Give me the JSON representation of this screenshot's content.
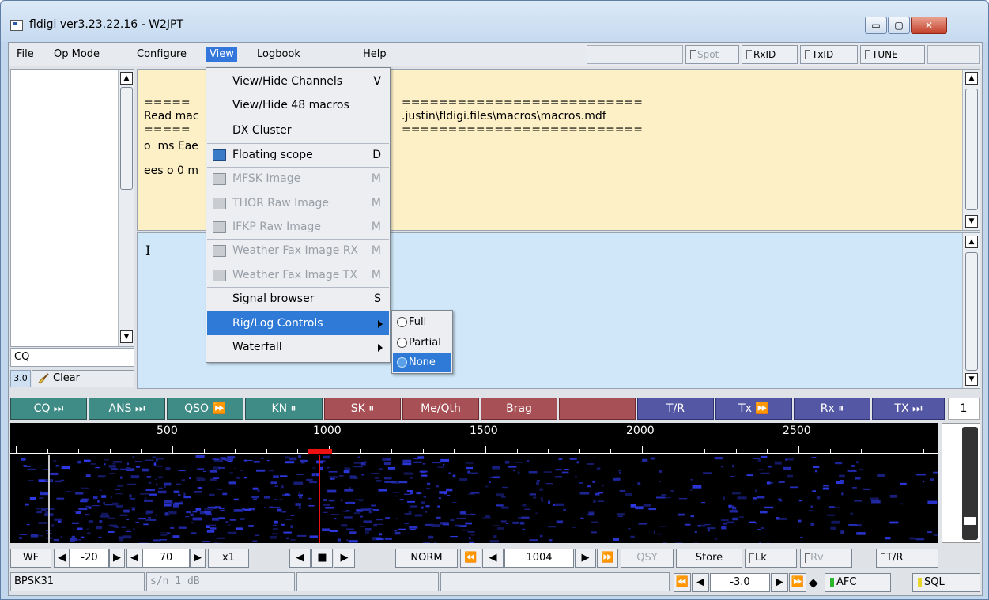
{
  "window": {
    "title": "fldigi ver3.23.22.16 - W2JPT",
    "minimize": "▭",
    "maximize": "▢",
    "close": "✕"
  },
  "menubar": {
    "items": [
      "File",
      "Op Mode",
      "Configure",
      "View",
      "Logbook",
      "Help"
    ],
    "spot": "Spot",
    "rxid": "RxID",
    "txid": "TxID",
    "tune": "TUNE"
  },
  "channel_panel": {
    "search_value": "CQ",
    "freq_step": "3.0",
    "clear_label": "Clear"
  },
  "rx_pane": {
    "lines": [
      "=====",
      "Read mac",
      "=====",
      "o  ms Eae",
      "",
      "ees o 0 m"
    ],
    "lines_right": [
      "==========================",
      ".justin\\fldigi.files\\macros\\macros.mdf",
      "=========================="
    ]
  },
  "tx_pane": {
    "cursor": "I"
  },
  "view_menu": {
    "items": [
      {
        "label": "View/Hide Channels",
        "shortcut": "V"
      },
      {
        "label": "View/Hide 48 macros",
        "shortcut": ""
      },
      {
        "label": "DX Cluster",
        "shortcut": ""
      },
      {
        "label": "Floating scope",
        "shortcut": "D"
      },
      {
        "label": "MFSK Image",
        "shortcut": "M"
      },
      {
        "label": "THOR Raw Image",
        "shortcut": "M"
      },
      {
        "label": "IFKP Raw Image",
        "shortcut": "M"
      },
      {
        "label": "Weather Fax Image RX",
        "shortcut": "M"
      },
      {
        "label": "Weather Fax Image TX",
        "shortcut": "M"
      },
      {
        "label": "Signal browser",
        "shortcut": "S"
      },
      {
        "label": "Rig/Log Controls",
        "shortcut": ""
      },
      {
        "label": "Waterfall",
        "shortcut": ""
      }
    ]
  },
  "rig_log_submenu": {
    "options": [
      "Full",
      "Partial",
      "None"
    ],
    "selected": "None"
  },
  "macros": {
    "buttons": [
      "CQ ⏭",
      "ANS ⏭",
      "QSO ⏩",
      "KN ⏸",
      "SK ⏸",
      "Me/Qth",
      "Brag",
      "",
      "T/R",
      "Tx ⏩",
      "Rx ⏸",
      "TX ⏭"
    ],
    "page": "1"
  },
  "waterfall": {
    "scale_labels": [
      "500",
      "1000",
      "1500",
      "2000",
      "2500"
    ]
  },
  "controls": {
    "wf": "WF",
    "ref_level": "-20",
    "range": "70",
    "zoom": "x1",
    "mode": "NORM",
    "carrier": "1004",
    "qsy": "QSY",
    "store": "Store",
    "lk": "Lk",
    "rv": "Rv",
    "tr": "T/R"
  },
  "status": {
    "mode": "BPSK31",
    "snr": "s/n  1 dB",
    "offset": "-3.0",
    "afc": "AFC",
    "sql": "SQL"
  },
  "colors": {
    "rx_bg": "#fdf0c6",
    "tx_bg": "#cfe7f8",
    "menu_highlight": "#2f7ad6",
    "macro_green": "#3f8c86",
    "macro_red": "#a75055",
    "macro_blue": "#5457a4"
  }
}
